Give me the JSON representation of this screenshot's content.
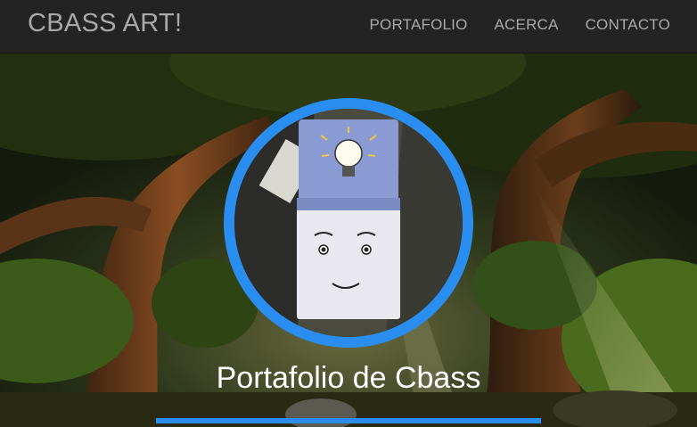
{
  "navbar": {
    "brand": "CBASS ART!",
    "links": [
      {
        "label": "PORTAFOLIO"
      },
      {
        "label": "ACERCA"
      },
      {
        "label": "CONTACTO"
      }
    ]
  },
  "hero": {
    "title": "Portafolio de Cbass"
  },
  "colors": {
    "navbar_bg": "#232323",
    "nav_text": "#a9a9a9",
    "accent": "#2a8ef0",
    "title_text": "#ffffff"
  },
  "icons": {
    "avatar_illustration": "lightbulb-character"
  }
}
